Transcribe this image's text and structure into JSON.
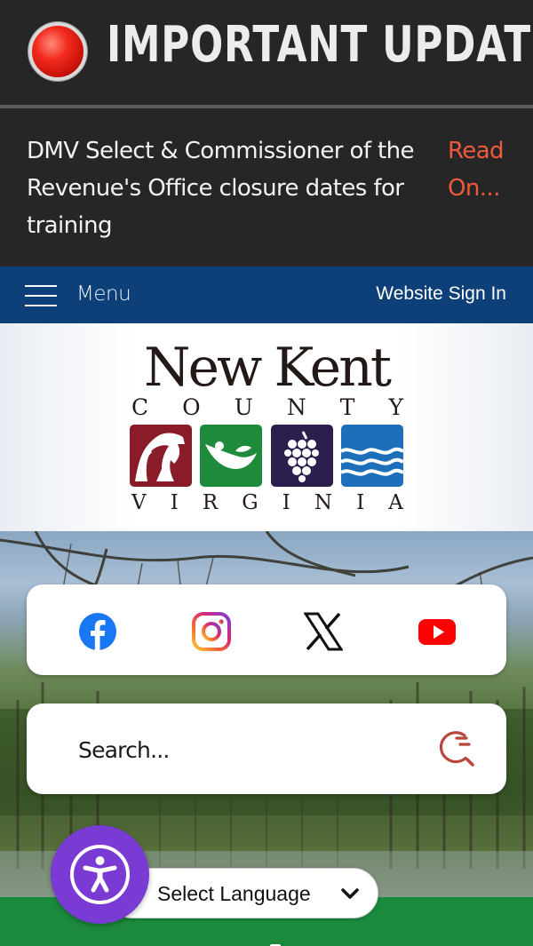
{
  "alert": {
    "title": "IMPORTANT UPDATES",
    "message": "DMV Select & Commissioner of the Revenue's Office closure dates for training",
    "read_more": "Read On..."
  },
  "nav": {
    "menu_label": "Menu",
    "sign_in": "Website Sign In"
  },
  "logo": {
    "name": "New Kent",
    "county_letters": [
      "C",
      "O",
      "U",
      "N",
      "T",
      "Y"
    ],
    "state_letters": [
      "V",
      "I",
      "R",
      "G",
      "I",
      "N",
      "I",
      "A"
    ],
    "tile_colors": [
      "#8a1c2a",
      "#1d8a3c",
      "#2d1f4d",
      "#1c6fb8"
    ]
  },
  "social": {
    "icons": [
      "facebook-icon",
      "instagram-icon",
      "x-icon",
      "youtube-icon"
    ],
    "colors": {
      "facebook": "#1877f2",
      "youtube": "#ff0000"
    }
  },
  "search": {
    "placeholder": "Search..."
  },
  "language": {
    "selected": "Select Language"
  },
  "colors": {
    "alert_bg": "#262626",
    "read_more": "#ef5a3c",
    "nav_bg": "#0d3f78",
    "accent_green": "#1b8a3d",
    "accessibility_purple": "#7a3bd4"
  }
}
